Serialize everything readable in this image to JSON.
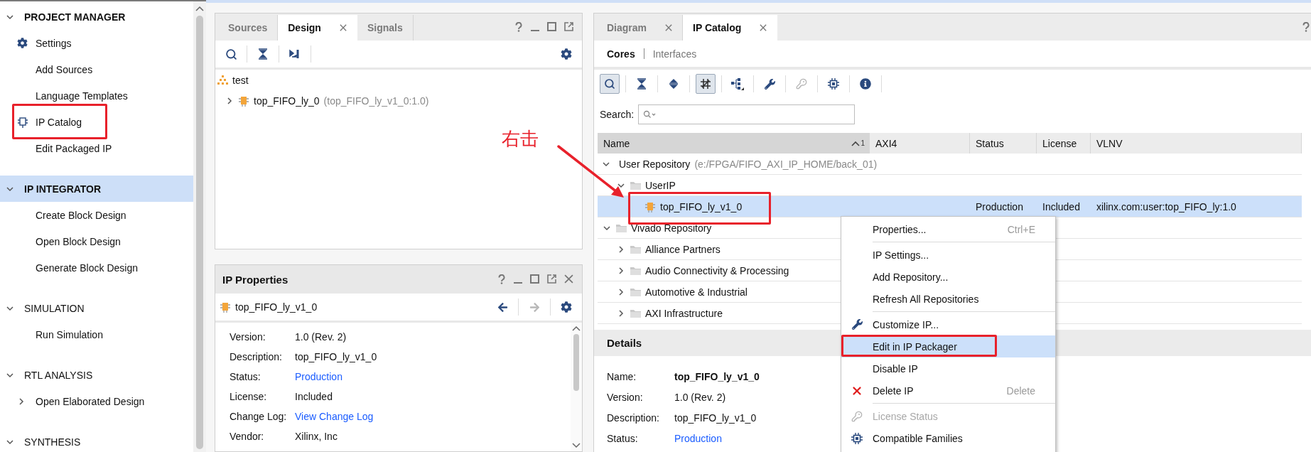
{
  "sidebar": {
    "sections": [
      {
        "title": "PROJECT MANAGER",
        "emphasized": true,
        "selected": false,
        "expanded": true,
        "items": [
          {
            "label": "Settings",
            "kind": "settings"
          },
          {
            "label": "Add Sources",
            "kind": "plain"
          },
          {
            "label": "Language Templates",
            "kind": "plain"
          },
          {
            "label": "IP Catalog",
            "kind": "catalog"
          },
          {
            "label": "Edit Packaged IP",
            "kind": "plain"
          }
        ]
      },
      {
        "title": "IP INTEGRATOR",
        "emphasized": true,
        "selected": true,
        "expanded": true,
        "items": [
          {
            "label": "Create Block Design",
            "kind": "plain"
          },
          {
            "label": "Open Block Design",
            "kind": "plain"
          },
          {
            "label": "Generate Block Design",
            "kind": "plain"
          }
        ]
      },
      {
        "title": "SIMULATION",
        "emphasized": false,
        "selected": false,
        "expanded": true,
        "items": [
          {
            "label": "Run Simulation",
            "kind": "plain"
          }
        ]
      },
      {
        "title": "RTL ANALYSIS",
        "emphasized": false,
        "selected": false,
        "expanded": true,
        "items": [
          {
            "label": "Open Elaborated Design",
            "kind": "group"
          }
        ]
      },
      {
        "title": "SYNTHESIS",
        "emphasized": false,
        "selected": false,
        "expanded": true
      }
    ]
  },
  "sources_panel": {
    "tabs": [
      {
        "label": "Sources",
        "selected": false,
        "closable": false
      },
      {
        "label": "Design",
        "selected": true,
        "closable": true
      },
      {
        "label": "Signals",
        "selected": false,
        "closable": false
      }
    ],
    "tree": [
      {
        "label": "test",
        "kind": "design",
        "children": [
          {
            "label": "top_FIFO_ly_0",
            "note": "(top_FIFO_ly_v1_0:1.0)",
            "kind": "ip",
            "expanded": false
          }
        ]
      }
    ]
  },
  "properties_panel": {
    "title": "IP Properties",
    "item": "top_FIFO_ly_v1_0",
    "nav": [
      {
        "kind": "back",
        "disabled": false
      },
      {
        "kind": "forward",
        "disabled": true
      }
    ],
    "fields": [
      {
        "label": "Version:",
        "value": "1.0 (Rev. 2)",
        "kind": "text"
      },
      {
        "label": "Description:",
        "value": "top_FIFO_ly_v1_0",
        "kind": "text"
      },
      {
        "label": "Status:",
        "value": "Production",
        "kind": "link"
      },
      {
        "label": "License:",
        "value": "Included",
        "kind": "text"
      },
      {
        "label": "Change Log:",
        "value": "View Change Log",
        "kind": "link"
      },
      {
        "label": "Vendor:",
        "value": "Xilinx, Inc",
        "kind": "text"
      }
    ]
  },
  "catalog_panel": {
    "tabs": [
      {
        "label": "Diagram",
        "selected": false,
        "closable": true
      },
      {
        "label": "IP Catalog",
        "selected": true,
        "closable": true
      }
    ],
    "views": [
      {
        "label": "Cores",
        "selected": true
      },
      {
        "label": "Interfaces",
        "selected": false
      }
    ],
    "toolbar": [
      {
        "kind": "search",
        "pressed": true,
        "disabled": false
      },
      {
        "kind": "collapse",
        "pressed": false,
        "disabled": false
      },
      {
        "kind": "expand",
        "pressed": false,
        "disabled": false
      },
      {
        "kind": "filter",
        "pressed": true,
        "disabled": false
      },
      {
        "kind": "hierarchy",
        "pressed": false,
        "disabled": false
      },
      {
        "kind": "customize",
        "pressed": false,
        "disabled": false
      },
      {
        "kind": "license",
        "pressed": false,
        "disabled": true
      },
      {
        "kind": "chip",
        "pressed": false,
        "disabled": false
      },
      {
        "kind": "info",
        "pressed": false,
        "disabled": false
      }
    ],
    "search_label": "Search:",
    "columns": [
      "Name",
      "AXI4",
      "Status",
      "License",
      "VLNV"
    ],
    "sort_rank": "1",
    "rows": [
      {
        "name": "User Repository",
        "note": "(e:/FPGA/FIFO_AXI_IP_HOME/back_01)",
        "kind": "folder",
        "expanded": true,
        "selected": false,
        "children": [
          {
            "name": "UserIP",
            "kind": "folder",
            "expanded": true,
            "selected": false,
            "children": [
              {
                "name": "top_FIFO_ly_v1_0",
                "kind": "ip",
                "selected": true,
                "status": "Production",
                "license": "Included",
                "vlnv": "xilinx.com:user:top_FIFO_ly:1.0"
              }
            ]
          }
        ]
      },
      {
        "name": "Vivado Repository",
        "kind": "folder",
        "expanded": true,
        "selected": false,
        "children": [
          {
            "name": "Alliance Partners",
            "kind": "folder",
            "expanded": false,
            "selected": false
          },
          {
            "name": "Audio Connectivity & Processing",
            "kind": "folder",
            "expanded": false,
            "selected": false
          },
          {
            "name": "Automotive & Industrial",
            "kind": "folder",
            "expanded": false,
            "selected": false
          },
          {
            "name": "AXI Infrastructure",
            "kind": "folder",
            "expanded": false,
            "selected": false
          }
        ]
      }
    ],
    "details": {
      "title": "Details",
      "fields": [
        {
          "label": "Name:",
          "value": "top_FIFO_ly_v1_0",
          "kind": "strong"
        },
        {
          "label": "Version:",
          "value": "1.0 (Rev. 2)",
          "kind": "text"
        },
        {
          "label": "Description:",
          "value": "top_FIFO_ly_v1_0",
          "kind": "text"
        },
        {
          "label": "Status:",
          "value": "Production",
          "kind": "link"
        }
      ]
    }
  },
  "context_menu": {
    "items": [
      {
        "label": "Properties...",
        "shortcut": "Ctrl+E",
        "kind": "command",
        "selected": false,
        "disabled": false
      },
      {
        "kind": "separator"
      },
      {
        "label": "IP Settings...",
        "kind": "command",
        "selected": false,
        "disabled": false
      },
      {
        "label": "Add Repository...",
        "kind": "command",
        "selected": false,
        "disabled": false
      },
      {
        "label": "Refresh All Repositories",
        "kind": "command",
        "selected": false,
        "disabled": false
      },
      {
        "kind": "separator"
      },
      {
        "label": "Customize IP...",
        "kind": "customize",
        "selected": false,
        "disabled": false
      },
      {
        "label": "Edit in IP Packager",
        "kind": "command",
        "selected": true,
        "disabled": false
      },
      {
        "label": "Disable IP",
        "kind": "command",
        "selected": false,
        "disabled": false
      },
      {
        "label": "Delete IP",
        "shortcut": "Delete",
        "kind": "delete",
        "selected": false,
        "disabled": false
      },
      {
        "kind": "separator"
      },
      {
        "label": "License Status",
        "kind": "license",
        "selected": false,
        "disabled": true
      },
      {
        "label": "Compatible Families",
        "kind": "families",
        "selected": false,
        "disabled": false
      }
    ]
  },
  "annotation": {
    "text": "右击"
  }
}
